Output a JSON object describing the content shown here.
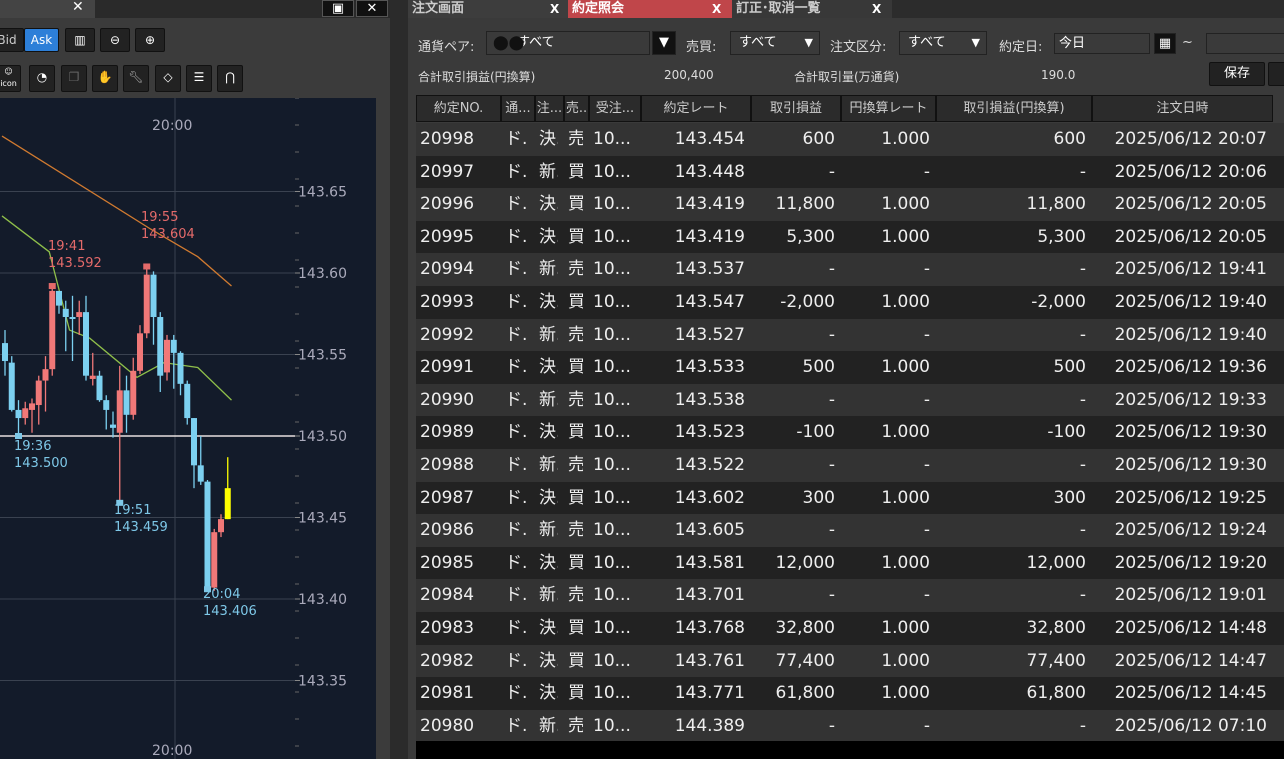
{
  "left_panel": {
    "buttons": {
      "bid": "Bid",
      "ask": "Ask",
      "icon": "icon"
    },
    "price_axis": [
      "143.65",
      "143.60",
      "143.55",
      "143.50",
      "143.45",
      "143.40",
      "143.35"
    ],
    "time_label_top": "20:00",
    "time_label_bottom": "20:00",
    "annotations": [
      {
        "time": "19:41",
        "price": "143.592",
        "color": "#e46a6a"
      },
      {
        "time": "19:55",
        "price": "143.604",
        "color": "#e46a6a"
      },
      {
        "time": "19:36",
        "price": "143.500",
        "color": "#7ec8e8"
      },
      {
        "time": "19:51",
        "price": "143.459",
        "color": "#7ec8e8"
      },
      {
        "time": "20:04",
        "price": "143.406",
        "color": "#7ec8e8"
      }
    ]
  },
  "chart_data": {
    "type": "candlestick",
    "ylim": [
      143.315,
      143.72
    ],
    "reference_line": 143.5,
    "up_color": "#f07878",
    "down_color": "#7cd0f0",
    "current_color": "#ffff00",
    "candles": [
      [
        143.557,
        143.565,
        143.537,
        143.546
      ],
      [
        143.545,
        143.549,
        143.515,
        143.516
      ],
      [
        143.516,
        143.522,
        143.5,
        143.511
      ],
      [
        143.511,
        143.521,
        143.507,
        143.517
      ],
      [
        143.516,
        143.523,
        143.502,
        143.52
      ],
      [
        143.519,
        143.537,
        143.507,
        143.534
      ],
      [
        143.534,
        143.549,
        143.515,
        143.541
      ],
      [
        143.541,
        143.592,
        143.537,
        143.589
      ],
      [
        143.589,
        143.589,
        143.575,
        143.58
      ],
      [
        143.578,
        143.583,
        143.552,
        143.573
      ],
      [
        143.573,
        143.586,
        143.546,
        143.572
      ],
      [
        143.573,
        143.583,
        143.562,
        143.576
      ],
      [
        143.576,
        143.586,
        143.534,
        143.537
      ],
      [
        143.535,
        143.551,
        143.531,
        143.537
      ],
      [
        143.537,
        143.54,
        143.521,
        143.522
      ],
      [
        143.522,
        143.525,
        143.504,
        143.516
      ],
      [
        143.507,
        143.515,
        143.499,
        143.505
      ],
      [
        143.502,
        143.543,
        143.459,
        143.528
      ],
      [
        143.528,
        143.537,
        143.502,
        143.513
      ],
      [
        143.513,
        143.548,
        143.51,
        143.54
      ],
      [
        143.54,
        143.568,
        143.538,
        143.563
      ],
      [
        143.563,
        143.604,
        143.56,
        143.599
      ],
      [
        143.599,
        143.601,
        143.556,
        143.573
      ],
      [
        143.573,
        143.576,
        143.527,
        143.537
      ],
      [
        143.539,
        143.562,
        143.534,
        143.559
      ],
      [
        143.559,
        143.562,
        143.529,
        143.551
      ],
      [
        143.551,
        143.552,
        143.525,
        143.532
      ],
      [
        143.532,
        143.534,
        143.507,
        143.511
      ],
      [
        143.511,
        143.511,
        143.468,
        143.482
      ],
      [
        143.482,
        143.5,
        143.47,
        143.472
      ],
      [
        143.472,
        143.473,
        143.406,
        143.407
      ],
      [
        143.407,
        143.443,
        143.405,
        143.441
      ],
      [
        143.441,
        143.452,
        143.438,
        143.449
      ],
      [
        143.449,
        143.487,
        143.449,
        143.468
      ]
    ],
    "ma_short": [
      [
        0,
        143.635
      ],
      [
        7,
        143.613
      ],
      [
        10,
        143.565
      ],
      [
        13,
        143.56
      ],
      [
        20,
        143.536
      ],
      [
        24,
        143.545
      ],
      [
        29,
        143.542
      ],
      [
        34,
        143.522
      ]
    ],
    "ma_long": [
      [
        0,
        143.684
      ],
      [
        22,
        143.627
      ],
      [
        29,
        143.61
      ],
      [
        34,
        143.592
      ]
    ],
    "ma_short_color": "#8fbf4a",
    "ma_long_color": "#d07a30"
  },
  "right_panel": {
    "tabs": [
      {
        "label": "注文画面",
        "active": false
      },
      {
        "label": "約定照会",
        "active": true
      },
      {
        "label": "訂正･取消一覧",
        "active": false
      }
    ],
    "close": "X",
    "filters": {
      "pair_label": "通貨ペア:",
      "pair_value": "すべて",
      "side_label": "売買:",
      "side_value": "すべて",
      "type_label": "注文区分:",
      "type_value": "すべて",
      "date_label": "約定日:",
      "date_value": "今日",
      "tilde": "~"
    },
    "summary": {
      "pl_label": "合計取引損益(円換算)",
      "pl_value": "200,400",
      "vol_label": "合計取引量(万通貨)",
      "vol_value": "190.0",
      "save": "保存"
    },
    "columns": [
      "約定NO.",
      "通...",
      "注...",
      "売..",
      "受注...",
      "約定レート",
      "取引損益",
      "円換算レート",
      "取引損益(円換算)",
      "注文日時"
    ],
    "rows": [
      [
        "20998",
        "ド...",
        "決...",
        "売",
        "10...",
        "143.454",
        "600",
        "1.000",
        "600",
        "2025/06/12 20:07"
      ],
      [
        "20997",
        "ド...",
        "新...",
        "買",
        "10...",
        "143.448",
        "-",
        "-",
        "-",
        "2025/06/12 20:06"
      ],
      [
        "20996",
        "ド...",
        "決...",
        "買",
        "10...",
        "143.419",
        "11,800",
        "1.000",
        "11,800",
        "2025/06/12 20:05"
      ],
      [
        "20995",
        "ド...",
        "決...",
        "買",
        "10...",
        "143.419",
        "5,300",
        "1.000",
        "5,300",
        "2025/06/12 20:05"
      ],
      [
        "20994",
        "ド...",
        "新...",
        "売",
        "10...",
        "143.537",
        "-",
        "-",
        "-",
        "2025/06/12 19:41"
      ],
      [
        "20993",
        "ド...",
        "決...",
        "買",
        "10...",
        "143.547",
        "-2,000",
        "1.000",
        "-2,000",
        "2025/06/12 19:40"
      ],
      [
        "20992",
        "ド...",
        "新...",
        "売",
        "10...",
        "143.527",
        "-",
        "-",
        "-",
        "2025/06/12 19:40"
      ],
      [
        "20991",
        "ド...",
        "決...",
        "買",
        "10...",
        "143.533",
        "500",
        "1.000",
        "500",
        "2025/06/12 19:36"
      ],
      [
        "20990",
        "ド...",
        "新...",
        "売",
        "10...",
        "143.538",
        "-",
        "-",
        "-",
        "2025/06/12 19:33"
      ],
      [
        "20989",
        "ド...",
        "決...",
        "買",
        "10...",
        "143.523",
        "-100",
        "1.000",
        "-100",
        "2025/06/12 19:30"
      ],
      [
        "20988",
        "ド...",
        "新...",
        "売",
        "10...",
        "143.522",
        "-",
        "-",
        "-",
        "2025/06/12 19:30"
      ],
      [
        "20987",
        "ド...",
        "決...",
        "買",
        "10...",
        "143.602",
        "300",
        "1.000",
        "300",
        "2025/06/12 19:25"
      ],
      [
        "20986",
        "ド...",
        "新...",
        "売",
        "10...",
        "143.605",
        "-",
        "-",
        "-",
        "2025/06/12 19:24"
      ],
      [
        "20985",
        "ド...",
        "決...",
        "買",
        "10...",
        "143.581",
        "12,000",
        "1.000",
        "12,000",
        "2025/06/12 19:20"
      ],
      [
        "20984",
        "ド...",
        "新...",
        "売",
        "10...",
        "143.701",
        "-",
        "-",
        "-",
        "2025/06/12 19:01"
      ],
      [
        "20983",
        "ド...",
        "決...",
        "買",
        "10...",
        "143.768",
        "32,800",
        "1.000",
        "32,800",
        "2025/06/12 14:48"
      ],
      [
        "20982",
        "ド...",
        "決...",
        "買",
        "10...",
        "143.761",
        "77,400",
        "1.000",
        "77,400",
        "2025/06/12 14:47"
      ],
      [
        "20981",
        "ド...",
        "決...",
        "買",
        "10...",
        "143.771",
        "61,800",
        "1.000",
        "61,800",
        "2025/06/12 14:45"
      ],
      [
        "20980",
        "ド...",
        "新...",
        "売",
        "10...",
        "144.389",
        "-",
        "-",
        "-",
        "2025/06/12 07:10"
      ]
    ]
  }
}
